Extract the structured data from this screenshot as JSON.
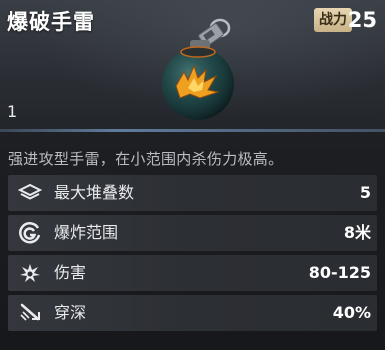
{
  "item": {
    "name": "爆破手雷",
    "power_label": "战力",
    "power_value": "25",
    "quantity": "1",
    "image_icon": "grenade-icon"
  },
  "description": "强进攻型手雷，在小范围内杀伤力极高。",
  "stats": [
    {
      "label": "最大堆叠数",
      "value": "5",
      "icon": "stack-icon"
    },
    {
      "label": "爆炸范围",
      "value": "8米",
      "icon": "blast-radius-icon"
    },
    {
      "label": "伤害",
      "value": "80-125",
      "icon": "damage-icon"
    },
    {
      "label": "穿深",
      "value": "40%",
      "icon": "penetration-icon"
    }
  ],
  "colors": {
    "badge_bg": "#d9c49c",
    "accent_blue": "#6a8bb0",
    "grenade_flame": "#f0a020"
  }
}
